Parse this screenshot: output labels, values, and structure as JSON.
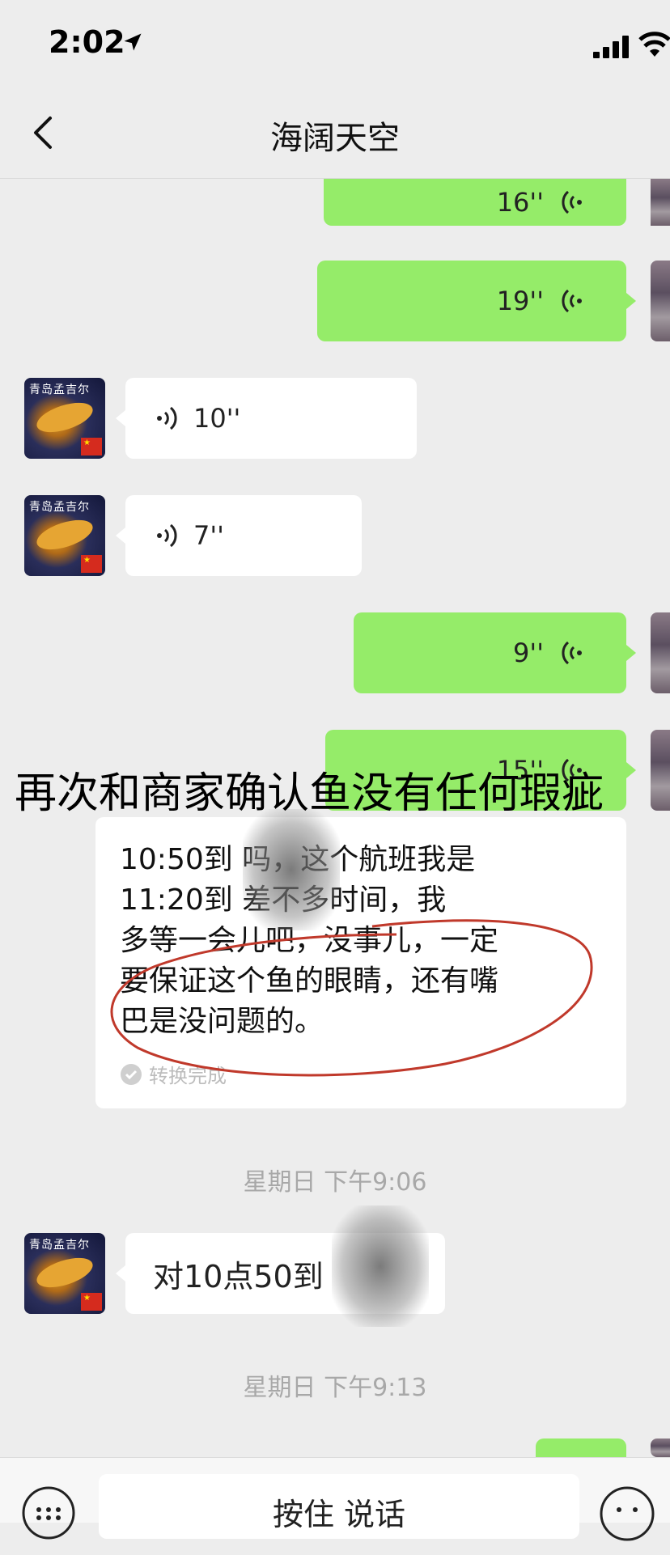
{
  "status_bar": {
    "time": "2:02"
  },
  "nav": {
    "title": "海阔天空"
  },
  "messages": [
    {
      "type": "voice",
      "side": "out",
      "duration": "16''"
    },
    {
      "type": "voice",
      "side": "out",
      "duration": "19''"
    },
    {
      "type": "voice",
      "side": "in",
      "duration": "10''"
    },
    {
      "type": "voice",
      "side": "in",
      "duration": "7''"
    },
    {
      "type": "voice",
      "side": "out",
      "duration": "9''"
    },
    {
      "type": "voice",
      "side": "out",
      "duration": "15''"
    }
  ],
  "transcript_card": {
    "lines": [
      "10:50到    吗，这个航班我是",
      "11:20到      差不多时间，我",
      "多等一会儿吧，没事儿，一定",
      "要保证这个鱼的眼睛，还有嘴",
      "巴是没问题的。"
    ],
    "status": "转换完成"
  },
  "overlay_caption": "再次和商家确认鱼没有任何瑕疵",
  "timestamps": [
    "星期日 下午9:06",
    "星期日 下午9:13"
  ],
  "incoming_text": "对10点50到",
  "contact_avatar_text": "青岛孟吉尔",
  "input_bar": {
    "hold_to_talk": "按住 说话"
  },
  "colors": {
    "outgoing_bubble": "#95ec69",
    "incoming_bubble": "#ffffff",
    "background": "#ededed",
    "annotation": "#c0392b"
  }
}
